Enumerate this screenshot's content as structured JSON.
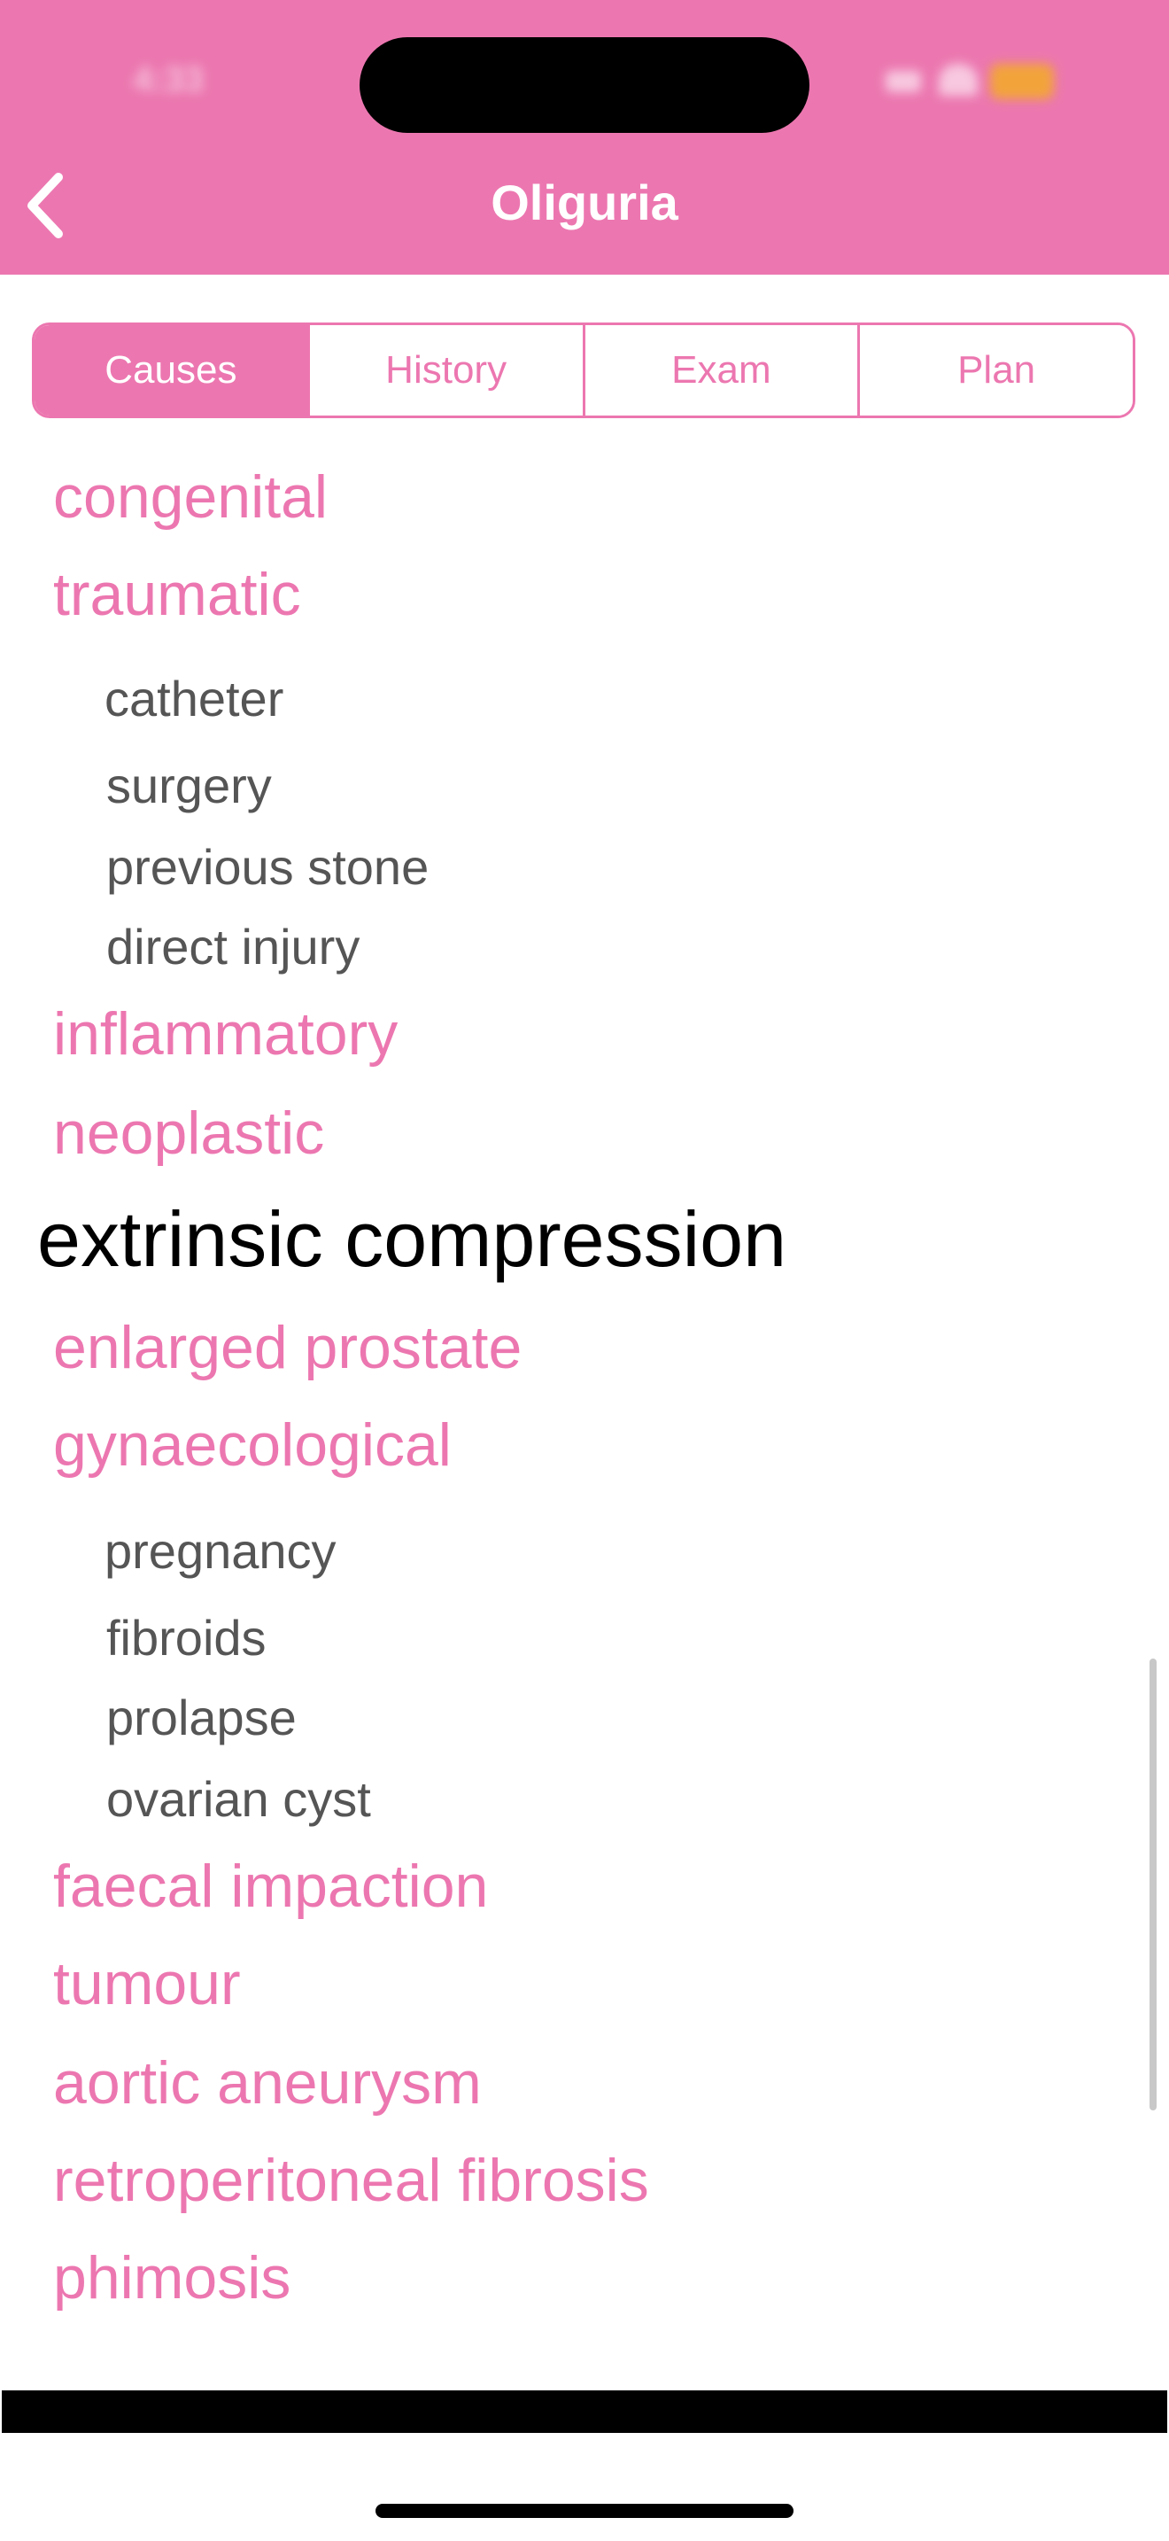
{
  "status_bar": {
    "time": "4:33"
  },
  "header": {
    "title": "Oliguria",
    "back_icon": "chevron-left-icon",
    "background_color": "#ec77b0"
  },
  "tabs": [
    {
      "label": "Causes",
      "active": true
    },
    {
      "label": "History",
      "active": false
    },
    {
      "label": "Exam",
      "active": false
    },
    {
      "label": "Plan",
      "active": false
    }
  ],
  "list": {
    "items": [
      {
        "type": "category",
        "text": "congenital"
      },
      {
        "type": "category",
        "text": "traumatic"
      },
      {
        "type": "sub",
        "text": "catheter"
      },
      {
        "type": "sub",
        "text": "surgery"
      },
      {
        "type": "sub",
        "text": "previous stone"
      },
      {
        "type": "sub",
        "text": "direct injury"
      },
      {
        "type": "category",
        "text": "inflammatory"
      },
      {
        "type": "category",
        "text": "neoplastic"
      },
      {
        "type": "heading",
        "text": "extrinsic compression"
      },
      {
        "type": "category",
        "text": "enlarged prostate"
      },
      {
        "type": "category",
        "text": "gynaecological"
      },
      {
        "type": "sub",
        "text": "pregnancy"
      },
      {
        "type": "sub",
        "text": "fibroids"
      },
      {
        "type": "sub",
        "text": "prolapse"
      },
      {
        "type": "sub",
        "text": "ovarian cyst"
      },
      {
        "type": "category",
        "text": "faecal impaction"
      },
      {
        "type": "category",
        "text": "tumour"
      },
      {
        "type": "category",
        "text": "aortic aneurysm"
      },
      {
        "type": "category",
        "text": "retroperitoneal fibrosis"
      },
      {
        "type": "category",
        "text": "phimosis"
      }
    ]
  },
  "colors": {
    "accent": "#ec77b0",
    "sub_text": "#555555",
    "heading_text": "#000000"
  }
}
